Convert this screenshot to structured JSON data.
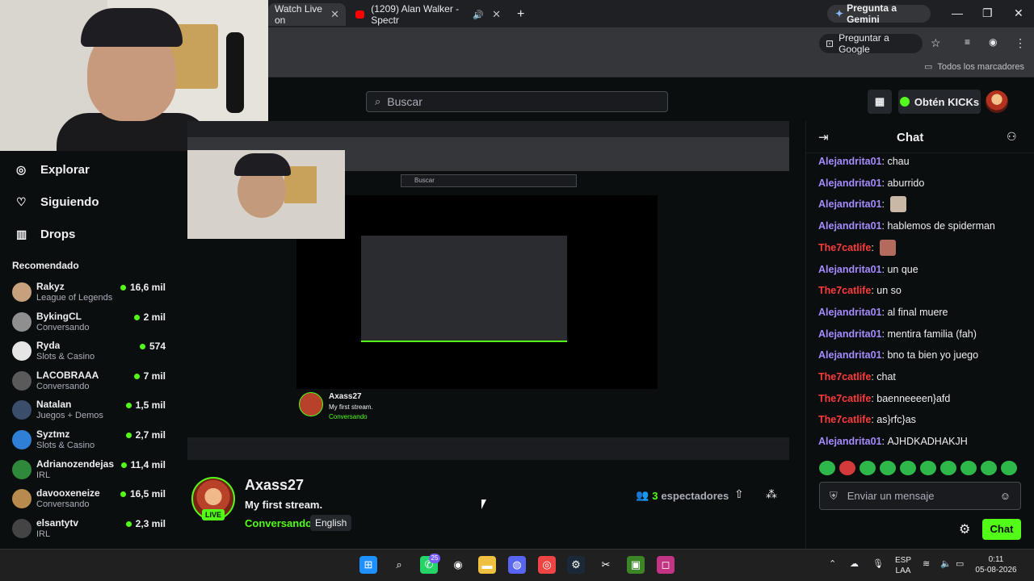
{
  "browser": {
    "tabs": [
      {
        "label": "Watch Live on",
        "active": true
      },
      {
        "label": "(1209) Alan Walker - Spectr",
        "active": false
      }
    ],
    "gemini_button": "Pregunta a Gemini",
    "google_pill": "Preguntar a Google",
    "bookmarks_label": "Todos los marcadores"
  },
  "kick": {
    "search_placeholder": "Buscar",
    "obten_label": "Obtén KICKs"
  },
  "sidebar": {
    "nav": [
      {
        "label": "Explorar",
        "icon": "compass-icon"
      },
      {
        "label": "Siguiendo",
        "icon": "heart-icon"
      },
      {
        "label": "Drops",
        "icon": "chart-icon"
      }
    ],
    "recommended_title": "Recomendado",
    "channels": [
      {
        "name": "Rakyz",
        "category": "League of Legends",
        "viewers": "16,6 mil",
        "color": "#c7a07d"
      },
      {
        "name": "BykingCL",
        "category": "Conversando",
        "viewers": "2 mil",
        "color": "#8f8f8f"
      },
      {
        "name": "Ryda",
        "category": "Slots & Casino",
        "viewers": "574",
        "color": "#e5e5e5"
      },
      {
        "name": "LACOBRAAA",
        "category": "Conversando",
        "viewers": "7 mil",
        "color": "#5a5a5a"
      },
      {
        "name": "Natalan",
        "category": "Juegos + Demos",
        "viewers": "1,5 mil",
        "color": "#3a4d6b"
      },
      {
        "name": "Syztmz",
        "category": "Slots & Casino",
        "viewers": "2,7 mil",
        "color": "#2f7fd6"
      },
      {
        "name": "Adrianozendejas",
        "category": "IRL",
        "viewers": "11,4 mil",
        "color": "#2e8a3a"
      },
      {
        "name": "davooxeneize",
        "category": "Conversando",
        "viewers": "16,5 mil",
        "color": "#b88a4e"
      },
      {
        "name": "elsantytv",
        "category": "IRL",
        "viewers": "2,3 mil",
        "color": "#444444"
      }
    ]
  },
  "stream": {
    "name": "Axass27",
    "title": "My first stream.",
    "category": "Conversando",
    "tag": "English",
    "live_label": "LIVE",
    "viewers_count": "3",
    "viewers_label": "espectadores"
  },
  "chat": {
    "title": "Chat",
    "messages": [
      {
        "user": "Alejandrita01",
        "text": "chau",
        "color": "p",
        "emote": ""
      },
      {
        "user": "Alejandrita01",
        "text": "aburrido",
        "color": "p",
        "emote": ""
      },
      {
        "user": "Alejandrita01",
        "text": "",
        "color": "p",
        "emote": "#c9b8a6"
      },
      {
        "user": "Alejandrita01",
        "text": "hablemos de spiderman",
        "color": "p",
        "emote": ""
      },
      {
        "user": "The7catlife",
        "text": "",
        "color": "r",
        "emote": "#b56a5e"
      },
      {
        "user": "Alejandrita01",
        "text": "un que",
        "color": "p",
        "emote": ""
      },
      {
        "user": "The7catlife",
        "text": "un so",
        "color": "r",
        "emote": ""
      },
      {
        "user": "Alejandrita01",
        "text": "al final muere",
        "color": "p",
        "emote": ""
      },
      {
        "user": "Alejandrita01",
        "text": "mentira familia (fah)",
        "color": "p",
        "emote": ""
      },
      {
        "user": "Alejandrita01",
        "text": "bno ta bien yo juego",
        "color": "p",
        "emote": ""
      },
      {
        "user": "The7catlife",
        "text": "chat",
        "color": "r",
        "emote": ""
      },
      {
        "user": "The7catlife",
        "text": "baenneeeen}afd",
        "color": "r",
        "emote": ""
      },
      {
        "user": "The7catlife",
        "text": "as}rfc}as",
        "color": "r",
        "emote": ""
      },
      {
        "user": "Alejandrita01",
        "text": "AJHDKADHAKJH",
        "color": "p",
        "emote": ""
      }
    ],
    "input_placeholder": "Enviar un mensaje",
    "send_label": "Chat"
  },
  "taskbar": {
    "lang": "ESP",
    "lang2": "LAA",
    "time": "0:11",
    "date": "05-08-2026",
    "whatsapp_badge": "25"
  },
  "colors": {
    "accent": "#53fc18",
    "purple_user": "#a58bff",
    "red_user": "#ff3b3b"
  }
}
